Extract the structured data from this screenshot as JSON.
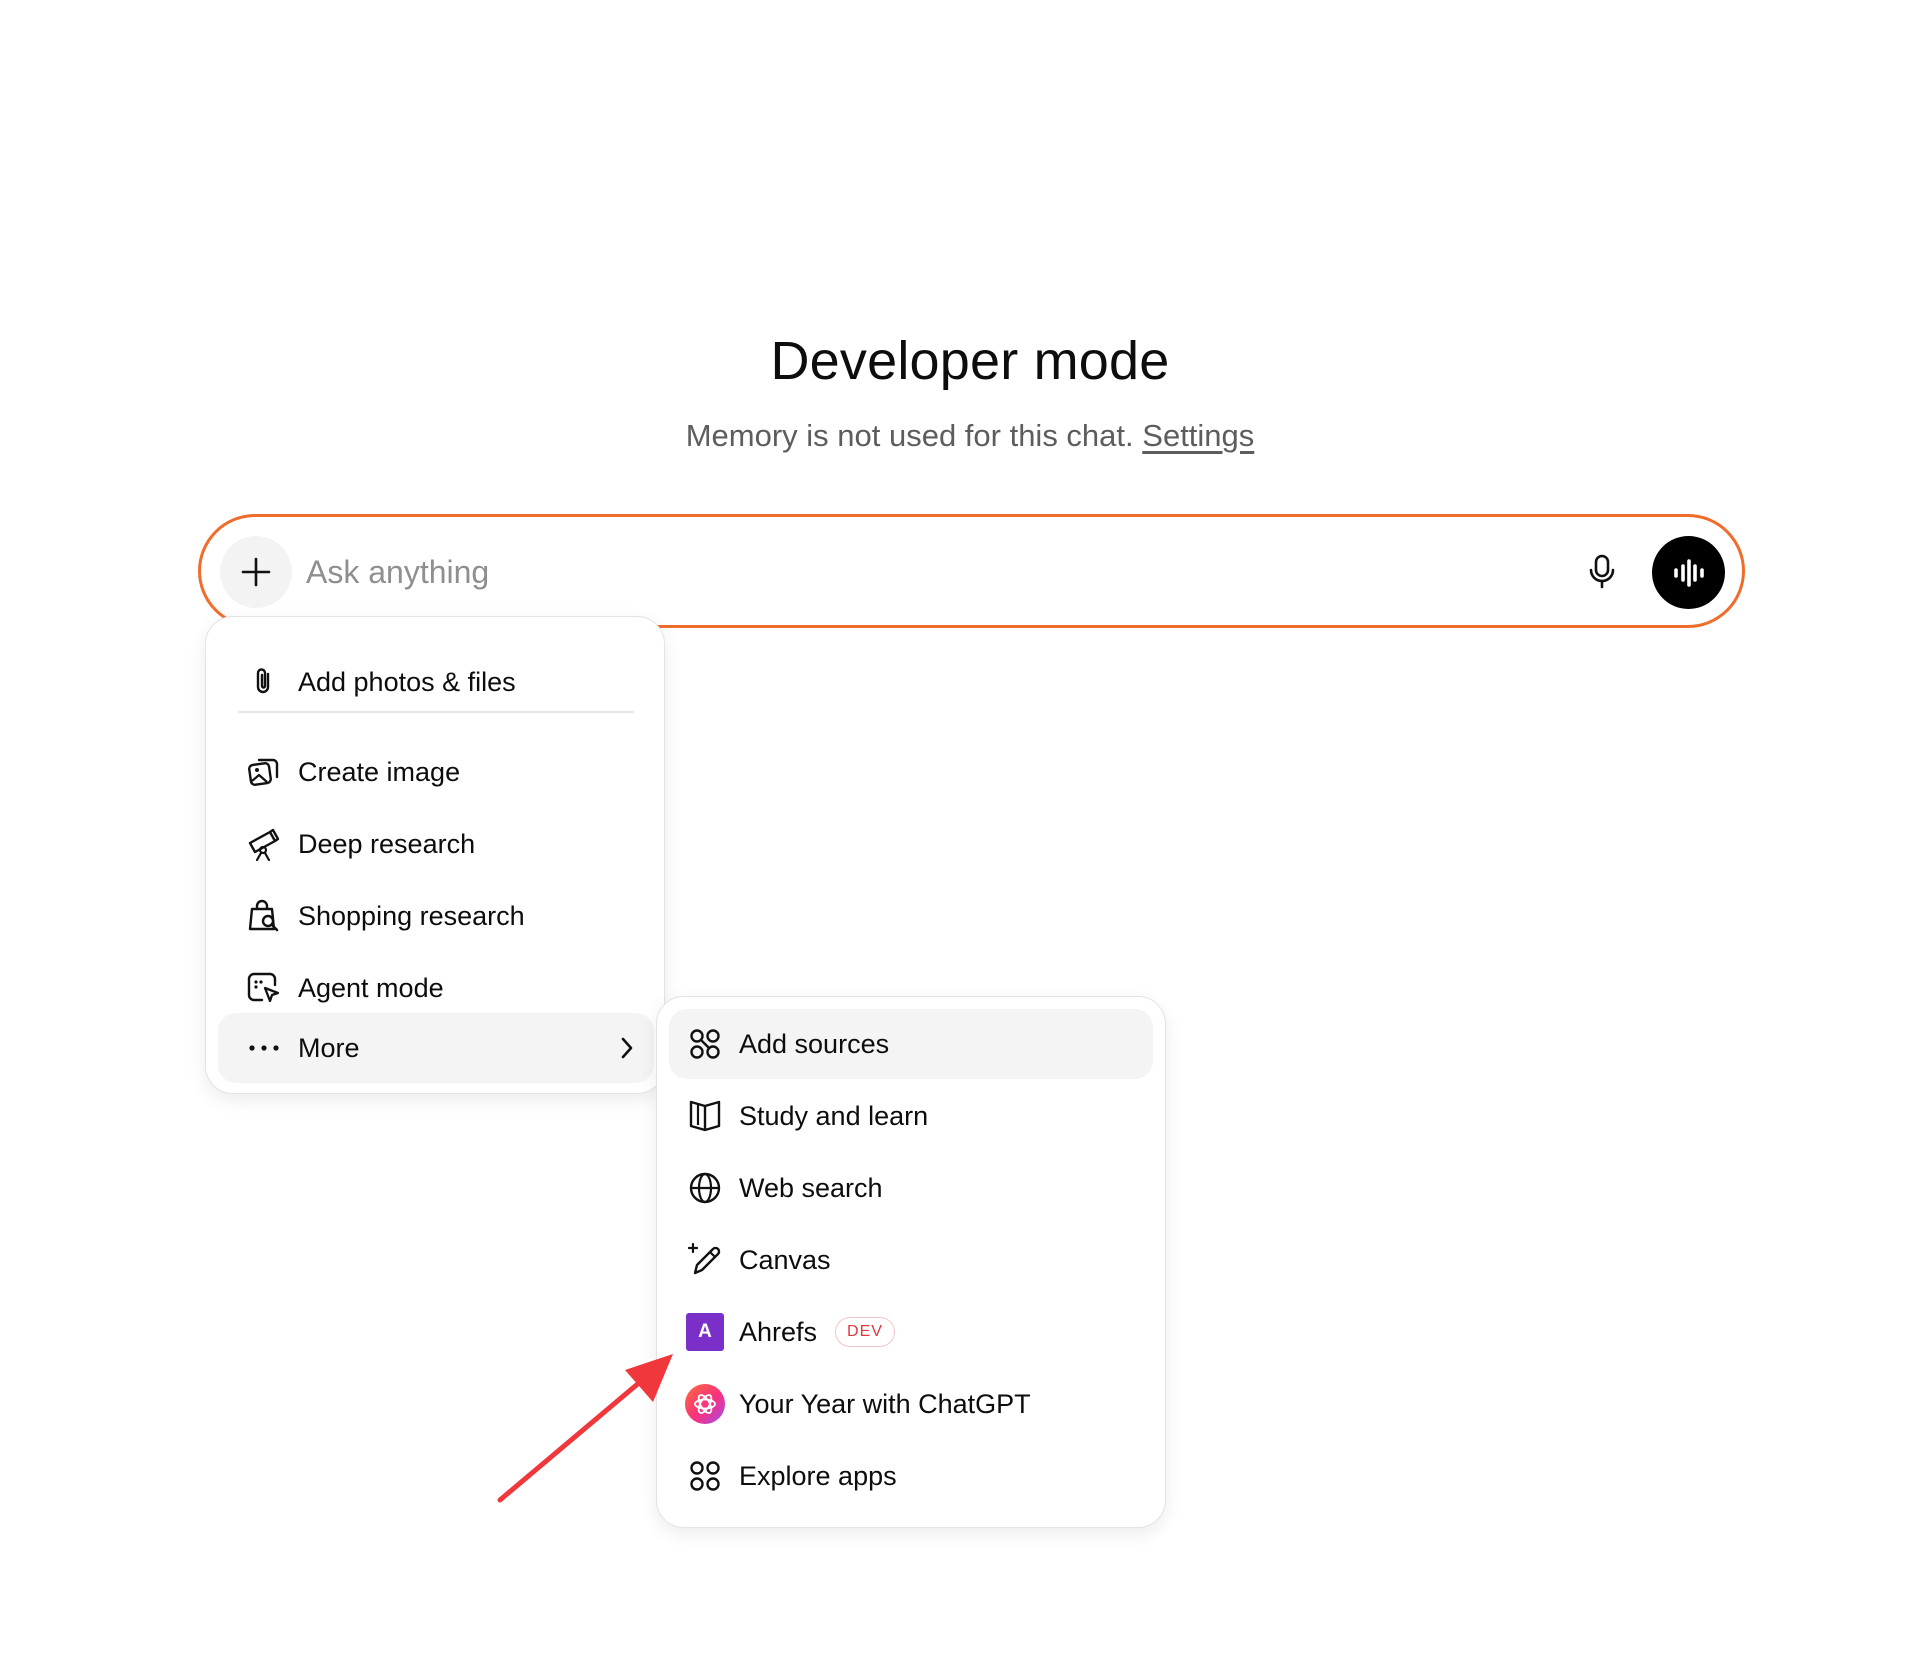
{
  "header": {
    "title": "Developer mode",
    "subtitle": "Memory is not used for this chat.",
    "settings_link": "Settings"
  },
  "composer": {
    "placeholder": "Ask anything",
    "value": "",
    "accent_color": "#f06c2b",
    "icons": {
      "plus": "plus-icon",
      "mic": "microphone-icon",
      "voice": "voice-waveform-icon"
    }
  },
  "menu": {
    "items": [
      {
        "label": "Add photos & files",
        "icon": "paperclip-icon"
      },
      {
        "label": "Create image",
        "icon": "image-create-icon"
      },
      {
        "label": "Deep research",
        "icon": "telescope-icon"
      },
      {
        "label": "Shopping research",
        "icon": "shopping-bag-search-icon"
      },
      {
        "label": "Agent mode",
        "icon": "agent-cursor-icon"
      },
      {
        "label": "More",
        "icon": "ellipsis-icon",
        "chevron": "chevron-right-icon"
      }
    ]
  },
  "more_menu": {
    "items": [
      {
        "label": "Add sources",
        "icon": "sources-icon"
      },
      {
        "label": "Study and learn",
        "icon": "open-book-icon"
      },
      {
        "label": "Web search",
        "icon": "globe-icon"
      },
      {
        "label": "Canvas",
        "icon": "pencil-sparkle-icon"
      },
      {
        "label": "Ahrefs",
        "icon": "ahrefs-logo",
        "logo_letter": "A",
        "badge": "DEV"
      },
      {
        "label": "Your Year with ChatGPT",
        "icon": "chatgpt-year-logo"
      },
      {
        "label": "Explore apps",
        "icon": "apps-grid-icon"
      }
    ]
  },
  "colors": {
    "ahrefs_brand": "#7a2fc9",
    "dev_badge": "#e0393e",
    "annotation_arrow": "#f0373c"
  }
}
